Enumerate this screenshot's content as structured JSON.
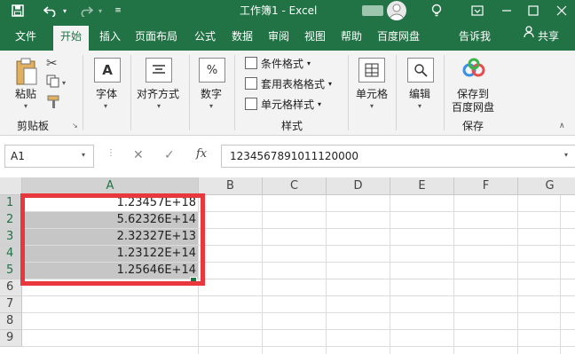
{
  "titlebar": {
    "title": "工作簿1  -  Excel",
    "icons": [
      "save-icon",
      "undo-icon",
      "redo-icon",
      "customize-icon",
      "avatar",
      "lightbulb-icon",
      "ribbon-display-icon",
      "minimize-icon",
      "maximize-icon",
      "close-icon"
    ]
  },
  "tabs": [
    "文件",
    "开始",
    "插入",
    "页面布局",
    "公式",
    "数据",
    "审阅",
    "视图",
    "帮助",
    "百度网盘",
    "告诉我",
    "共享"
  ],
  "active_tab": "开始",
  "ribbon": {
    "clipboard": {
      "paste": "粘贴",
      "group": "剪贴板"
    },
    "font": {
      "label": "字体"
    },
    "alignment": {
      "label": "对齐方式"
    },
    "number": {
      "label": "数字",
      "symbol": "%"
    },
    "styles": {
      "conditional": "条件格式",
      "table": "套用表格格式",
      "cell": "单元格样式",
      "group": "样式"
    },
    "cells": {
      "label": "单元格"
    },
    "editing": {
      "label": "编辑"
    },
    "save": {
      "label1": "保存到",
      "label2": "百度网盘",
      "group": "保存"
    }
  },
  "formula_bar": {
    "name_box": "A1",
    "fx": "fx",
    "value": "1234567891011120000"
  },
  "sheet": {
    "columns": [
      "A",
      "B",
      "C",
      "D",
      "E",
      "F",
      "G"
    ],
    "rows": [
      "1",
      "2",
      "3",
      "4",
      "5",
      "6",
      "7",
      "8",
      "9"
    ],
    "cells": [
      "1.23457E+18",
      "5.62326E+14",
      "2.32327E+13",
      "1.23122E+14",
      "1.25646E+14"
    ]
  },
  "colors": {
    "excel_green": "#217346",
    "selection_fill": "#c6c6c6",
    "highlight_border": "#e8383d"
  }
}
